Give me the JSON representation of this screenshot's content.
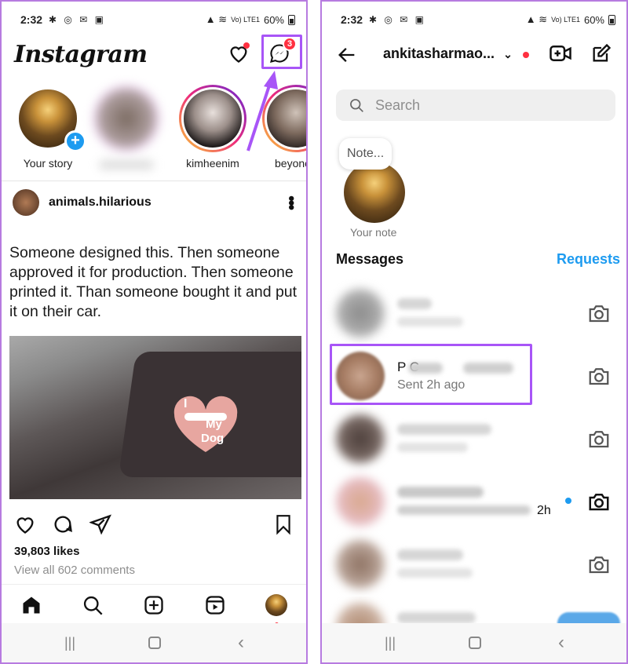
{
  "left": {
    "status": {
      "time": "2:32",
      "signal": "Vo) LTE1",
      "battery": "60%"
    },
    "header": {
      "logo": "Instagram",
      "messenger_badge": "3"
    },
    "stories": [
      {
        "label": "Your story"
      },
      {
        "label": ""
      },
      {
        "label": "kimheenim"
      },
      {
        "label": "beyonc"
      }
    ],
    "post": {
      "username": "animals.hilarious",
      "text": "Someone designed this. Then someone approved it for production. Then someone printed it. Than someone bought it and put it on their car.",
      "sticker_top": "I",
      "sticker_mid": "My",
      "sticker_bottom": "Dog",
      "likes": "39,803 likes",
      "comments": "View all 602 comments"
    }
  },
  "right": {
    "status": {
      "time": "2:32",
      "signal": "Vo) LTE1",
      "battery": "60%"
    },
    "header": {
      "username": "ankitasharmao..."
    },
    "search": {
      "placeholder": "Search"
    },
    "note": {
      "bubble": "Note...",
      "label": "Your note"
    },
    "messages_heading": "Messages",
    "requests_link": "Requests",
    "threads": [
      {
        "name": "",
        "sub": ""
      },
      {
        "name": "P          C",
        "sub": "Sent 2h ago"
      },
      {
        "name": "",
        "sub": ""
      },
      {
        "name": "",
        "sub": "",
        "time": "2h"
      },
      {
        "name": "",
        "sub": ""
      }
    ]
  },
  "colors": {
    "accent": "#1d9bf0",
    "highlight": "#a855f7",
    "badge": "#ff3040"
  }
}
